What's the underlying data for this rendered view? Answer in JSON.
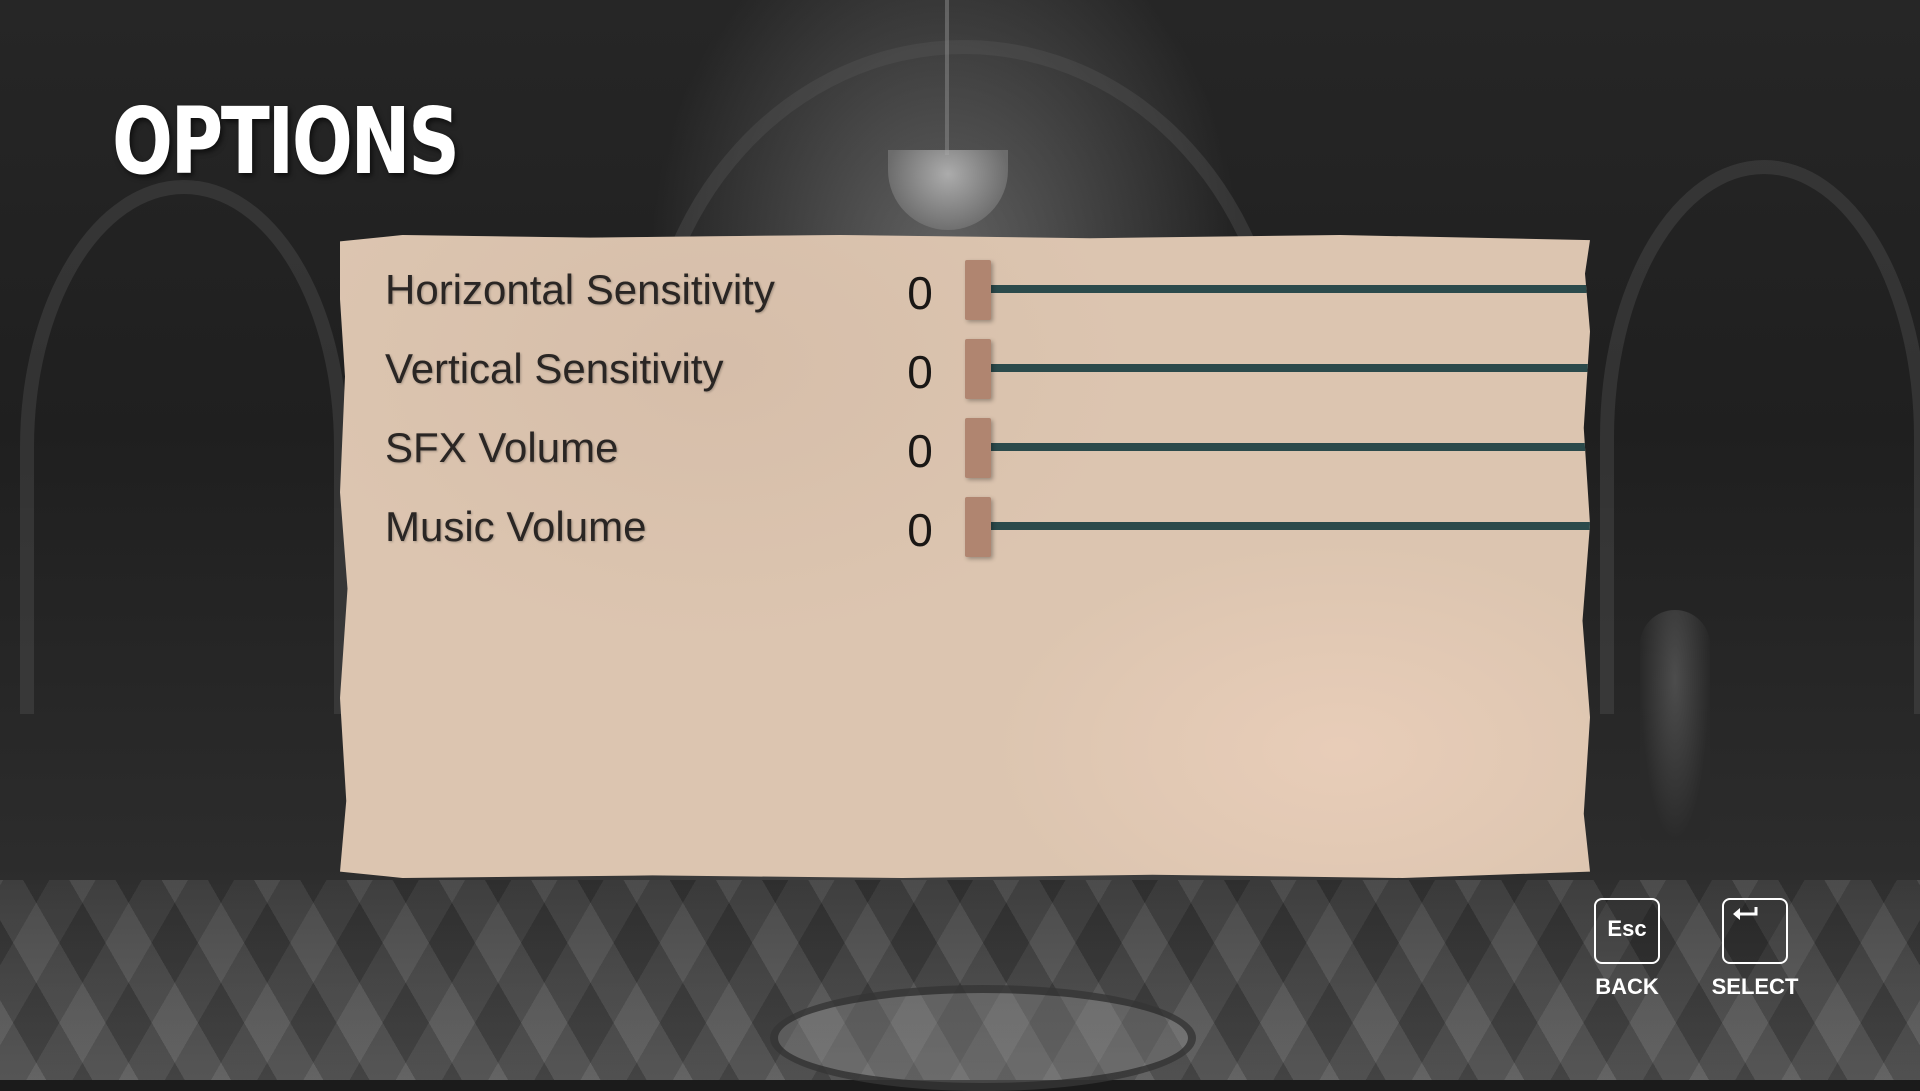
{
  "screen": {
    "title": "OPTIONS"
  },
  "options": [
    {
      "label": "Horizontal Sensitivity",
      "value": "0",
      "level": 0
    },
    {
      "label": "Vertical Sensitivity",
      "value": "0",
      "level": 0
    },
    {
      "label": "SFX Volume",
      "value": "0",
      "level": 0
    },
    {
      "label": "Music Volume",
      "value": "0",
      "level": 0
    }
  ],
  "controls": {
    "back": {
      "key": "Esc",
      "label": "BACK",
      "icon": "esc-key-icon"
    },
    "select": {
      "key": "",
      "label": "SELECT",
      "icon": "enter-key-icon"
    }
  },
  "colors": {
    "panel": "#dcc5b0",
    "track": "#2b4a4b",
    "thumb": "#b08570",
    "text": "#2a2624"
  }
}
